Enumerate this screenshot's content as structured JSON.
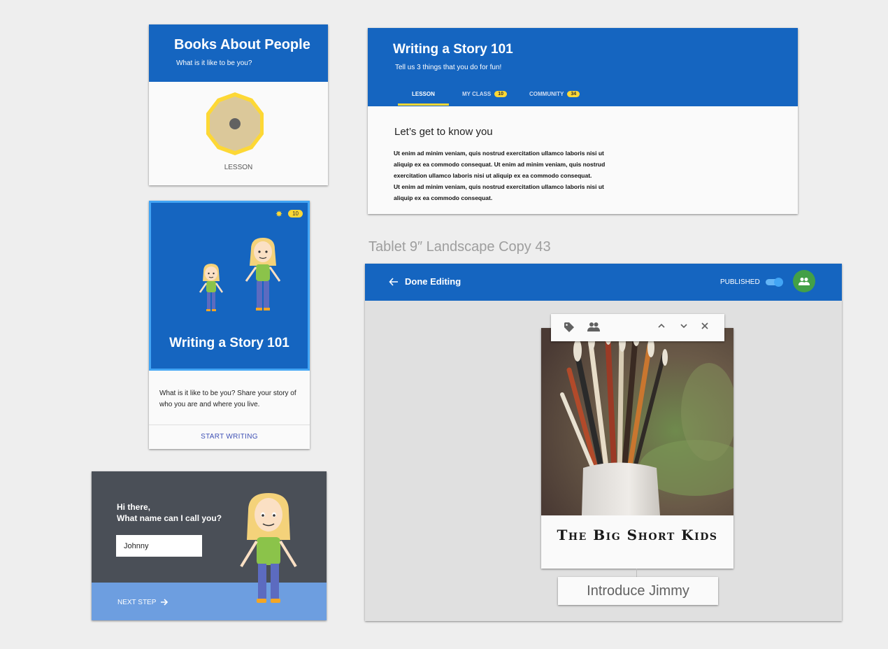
{
  "card_books": {
    "title": "Books About People",
    "subtitle": "What is it like to be you?",
    "badge_label": "LESSON",
    "colors": {
      "header": "#1565c0",
      "badge": "#fdd835"
    }
  },
  "card_story": {
    "badge_count": "10",
    "title": "Writing a Story 101",
    "description": "What is it like to be you? Share your story of who you are and where you live.",
    "action_label": "START WRITING"
  },
  "card_name": {
    "greeting": "Hi there,",
    "question": "What name can I call you?",
    "name_value": "Johnny",
    "next_label": "NEXT STEP"
  },
  "lesson_panel": {
    "title": "Writing a Story 101",
    "subtitle": "Tell us 3 things that you do for fun!",
    "tabs": [
      {
        "label": "LESSON",
        "count": "",
        "active": true
      },
      {
        "label": "MY CLASS",
        "count": "10",
        "active": false
      },
      {
        "label": "COMMUNITY",
        "count": "34",
        "active": false
      }
    ],
    "heading": "Let’s get to know you",
    "body_lines": [
      "Ut enim ad minim veniam, quis nostrud exercitation ullamco laboris nisi ut",
      "aliquip ex ea commodo consequat.  Ut enim ad minim veniam, quis nostrud",
      "exercitation ullamco laboris nisi ut aliquip ex ea commodo consequat.",
      "Ut enim ad minim veniam, quis nostrud exercitation ullamco laboris nisi ut",
      "aliquip ex ea commodo consequat."
    ]
  },
  "tablet": {
    "frame_label": "Tablet 9″ Landscape Copy 43",
    "back_label": "Done Editing",
    "published_label": "PUBLISHED",
    "published_on": true,
    "book_title": "The Big Short Kids",
    "chapter_label": "Introduce Jimmy",
    "toolbar_icons": [
      "tag-icon",
      "people-icon",
      "chevron-up-icon",
      "chevron-down-icon",
      "close-icon"
    ],
    "colors": {
      "bar": "#1565c0",
      "avatar": "#43a047"
    }
  }
}
